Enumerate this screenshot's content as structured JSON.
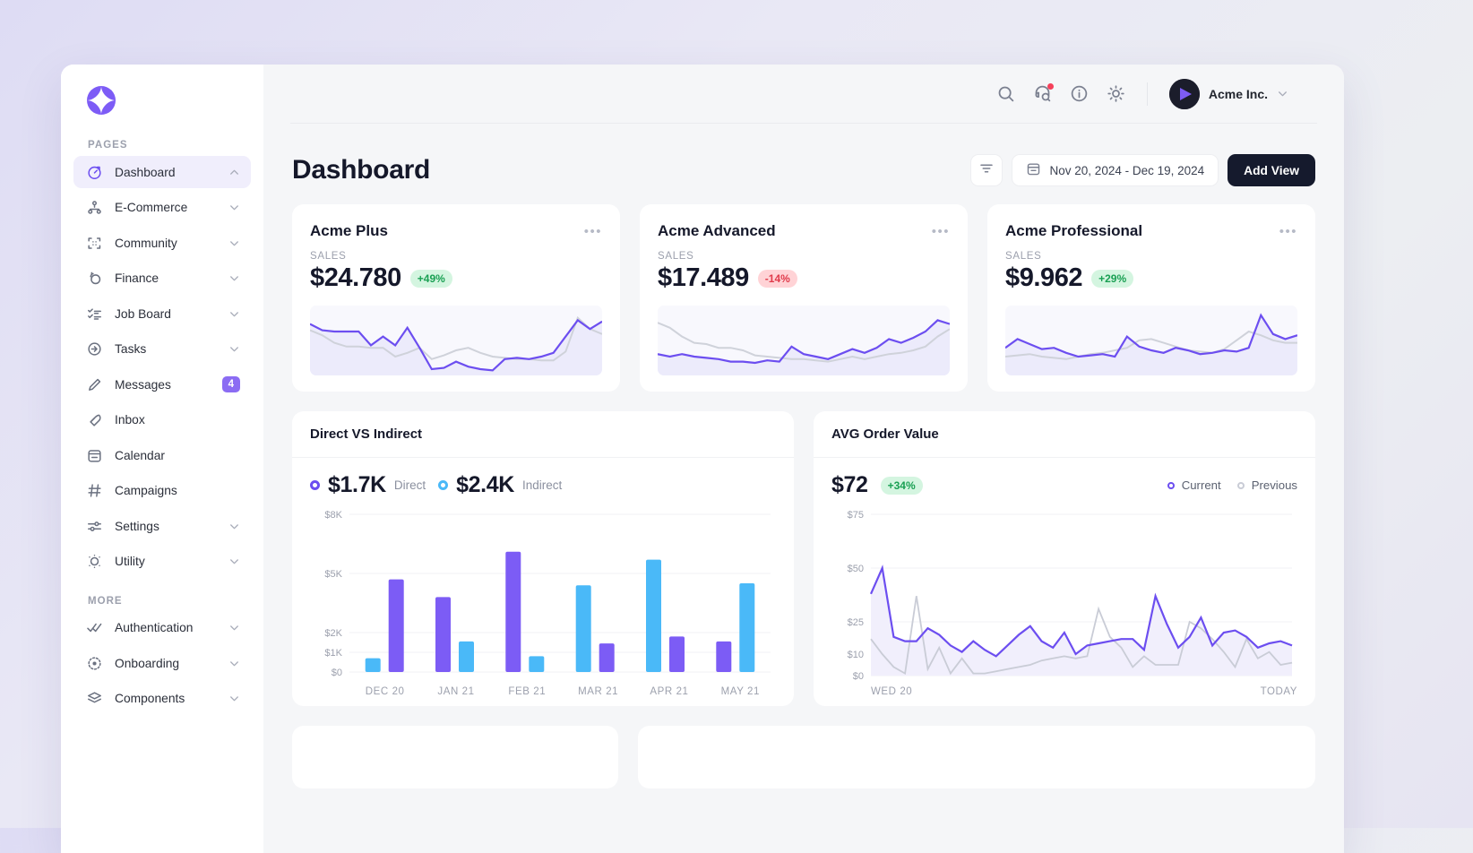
{
  "brand": {
    "logo_icon": "acme-diamond-logo",
    "accent": "#6c4ef0",
    "blue": "#4ab9f8"
  },
  "sidebar": {
    "sections": [
      {
        "label": "PAGES",
        "items": [
          {
            "label": "Dashboard",
            "icon": "gauge-icon",
            "active": true,
            "chevron": "up",
            "badge": null
          },
          {
            "label": "E-Commerce",
            "icon": "sitemap-icon",
            "active": false,
            "chevron": "down",
            "badge": null
          },
          {
            "label": "Community",
            "icon": "collapse-icon",
            "active": false,
            "chevron": "down",
            "badge": null
          },
          {
            "label": "Finance",
            "icon": "coins-icon",
            "active": false,
            "chevron": "down",
            "badge": null
          },
          {
            "label": "Job Board",
            "icon": "checklist-icon",
            "active": false,
            "chevron": "down",
            "badge": null
          },
          {
            "label": "Tasks",
            "icon": "arrow-in-circle-icon",
            "active": false,
            "chevron": "down",
            "badge": null
          },
          {
            "label": "Messages",
            "icon": "pencil-icon",
            "active": false,
            "chevron": null,
            "badge": "4"
          },
          {
            "label": "Inbox",
            "icon": "feather-icon",
            "active": false,
            "chevron": null,
            "badge": null
          },
          {
            "label": "Calendar",
            "icon": "calendar-icon",
            "active": false,
            "chevron": null,
            "badge": null
          },
          {
            "label": "Campaigns",
            "icon": "hash-icon",
            "active": false,
            "chevron": null,
            "badge": null
          },
          {
            "label": "Settings",
            "icon": "sliders-icon",
            "active": false,
            "chevron": "down",
            "badge": null
          },
          {
            "label": "Utility",
            "icon": "dotted-circle-icon",
            "active": false,
            "chevron": "down",
            "badge": null
          }
        ]
      },
      {
        "label": "MORE",
        "items": [
          {
            "label": "Authentication",
            "icon": "double-check-icon",
            "active": false,
            "chevron": "down",
            "badge": null
          },
          {
            "label": "Onboarding",
            "icon": "target-icon",
            "active": false,
            "chevron": "down",
            "badge": null
          },
          {
            "label": "Components",
            "icon": "layers-icon",
            "active": false,
            "chevron": "down",
            "badge": null
          }
        ]
      }
    ]
  },
  "topbar": {
    "icons": [
      "search-icon",
      "support-icon",
      "info-icon",
      "theme-icon"
    ],
    "notification_dot": true,
    "user_name": "Acme Inc.",
    "user_chevron": "chevron-down-icon"
  },
  "header": {
    "title": "Dashboard",
    "filter_icon": "filter-icon",
    "date_icon": "calendar-icon",
    "date_range": "Nov 20, 2024 - Dec 19, 2024",
    "add_view_label": "Add View"
  },
  "kpis": [
    {
      "name": "Acme Plus",
      "sub": "SALES",
      "value": "$24.780",
      "delta": "+49%",
      "direction": "up",
      "chart_data": {
        "type": "line",
        "title": "Acme Plus sales sparkline",
        "series": [
          {
            "name": "current",
            "color": "#6c4ef0",
            "values": [
              82,
              72,
              70,
              70,
              70,
              48,
              62,
              48,
              76,
              44,
              10,
              12,
              22,
              14,
              10,
              8,
              26,
              28,
              26,
              30,
              36,
              62,
              88,
              74,
              86
            ]
          },
          {
            "name": "previous",
            "color": "#cfd2da",
            "values": [
              72,
              64,
              52,
              46,
              46,
              44,
              44,
              30,
              36,
              44,
              26,
              32,
              40,
              44,
              36,
              30,
              28,
              26,
              26,
              24,
              24,
              38,
              92,
              74,
              66
            ]
          }
        ],
        "ymin": 0,
        "ymax": 100
      }
    },
    {
      "name": "Acme Advanced",
      "sub": "SALES",
      "value": "$17.489",
      "delta": "-14%",
      "direction": "down",
      "chart_data": {
        "type": "line",
        "title": "Acme Advanced sales sparkline",
        "series": [
          {
            "name": "current",
            "color": "#6c4ef0",
            "values": [
              34,
              30,
              34,
              30,
              28,
              26,
              22,
              22,
              20,
              24,
              22,
              46,
              34,
              30,
              26,
              34,
              42,
              36,
              44,
              58,
              52,
              60,
              70,
              88,
              82
            ]
          },
          {
            "name": "previous",
            "color": "#cfd2da",
            "values": [
              84,
              76,
              62,
              52,
              50,
              44,
              44,
              40,
              32,
              30,
              28,
              26,
              26,
              24,
              22,
              26,
              30,
              26,
              30,
              34,
              36,
              40,
              46,
              62,
              74
            ]
          }
        ],
        "ymin": 0,
        "ymax": 100
      }
    },
    {
      "name": "Acme Professional",
      "sub": "SALES",
      "value": "$9.962",
      "delta": "+29%",
      "direction": "up",
      "chart_data": {
        "type": "line",
        "title": "Acme Professional sales sparkline",
        "series": [
          {
            "name": "current",
            "color": "#6c4ef0",
            "values": [
              44,
              58,
              50,
              42,
              44,
              36,
              30,
              32,
              34,
              30,
              62,
              46,
              40,
              36,
              44,
              40,
              34,
              36,
              40,
              38,
              44,
              96,
              66,
              58,
              64
            ]
          },
          {
            "name": "previous",
            "color": "#cfd2da",
            "values": [
              30,
              32,
              34,
              30,
              28,
              26,
              30,
              34,
              36,
              40,
              44,
              56,
              58,
              52,
              46,
              40,
              38,
              36,
              42,
              56,
              70,
              64,
              56,
              52,
              52
            ]
          }
        ],
        "ymin": 0,
        "ymax": 100
      }
    }
  ],
  "direct_indirect": {
    "title": "Direct VS Indirect",
    "legend": [
      {
        "value": "$1.7K",
        "name": "Direct",
        "color": "#6c4ef0"
      },
      {
        "value": "$2.4K",
        "name": "Indirect",
        "color": "#4ab9f8"
      }
    ],
    "chart_data": {
      "type": "bar",
      "title": "Direct VS Indirect",
      "categories": [
        "DEC 20",
        "JAN 21",
        "FEB 21",
        "MAR 21",
        "APR 21",
        "MAY 21"
      ],
      "series": [
        {
          "name": "Direct",
          "color": "#7c5cf5",
          "values": [
            4700,
            3800,
            6100,
            1450,
            1800,
            1550
          ]
        },
        {
          "name": "Indirect",
          "color": "#4ab9f8",
          "values": [
            700,
            1550,
            800,
            4400,
            5700,
            4500
          ]
        }
      ],
      "bar_order": [
        "Indirect",
        "Direct",
        "Direct",
        "Indirect",
        "Indirect",
        "Direct",
        "Direct",
        "Indirect",
        "Direct",
        "Indirect",
        "Direct",
        "Indirect"
      ],
      "ytick_labels": [
        "$8K",
        "$5K",
        "$2K",
        "$1K",
        "$0"
      ],
      "ytick_values": [
        8000,
        5000,
        2000,
        1000,
        0
      ],
      "ylim": [
        0,
        8000
      ],
      "xlabel": "",
      "ylabel": "",
      "grid": true,
      "legend_position": "top-left"
    }
  },
  "avg_order": {
    "title": "AVG Order Value",
    "value": "$72",
    "delta": "+34%",
    "direction": "up",
    "legend": [
      {
        "name": "Current",
        "color": "#6c4ef0"
      },
      {
        "name": "Previous",
        "color": "#c9ccd6"
      }
    ],
    "chart_data": {
      "type": "area",
      "title": "AVG Order Value",
      "x_start_label": "WED 20",
      "x_end_label": "TODAY",
      "ytick_labels": [
        "$75",
        "$50",
        "$25",
        "$10",
        "$0"
      ],
      "ytick_values": [
        75,
        50,
        25,
        10,
        0
      ],
      "ylim": [
        0,
        75
      ],
      "grid": true,
      "legend_position": "top-right",
      "series": [
        {
          "name": "Current",
          "color": "#6c4ef0",
          "values": [
            38,
            50,
            18,
            16,
            16,
            22,
            19,
            14,
            11,
            16,
            12,
            9,
            14,
            19,
            23,
            16,
            13,
            20,
            10,
            14,
            15,
            16,
            17,
            17,
            12,
            37,
            24,
            13,
            18,
            27,
            14,
            20,
            21,
            18,
            13,
            15,
            16,
            14
          ]
        },
        {
          "name": "Previous",
          "color": "#c9ccd6",
          "values": [
            17,
            10,
            4,
            1,
            37,
            3,
            13,
            1,
            8,
            1,
            1,
            2,
            3,
            4,
            5,
            7,
            8,
            9,
            8,
            9,
            31,
            18,
            13,
            4,
            9,
            5,
            5,
            5,
            25,
            22,
            17,
            11,
            4,
            17,
            8,
            11,
            5,
            6
          ]
        }
      ]
    }
  }
}
